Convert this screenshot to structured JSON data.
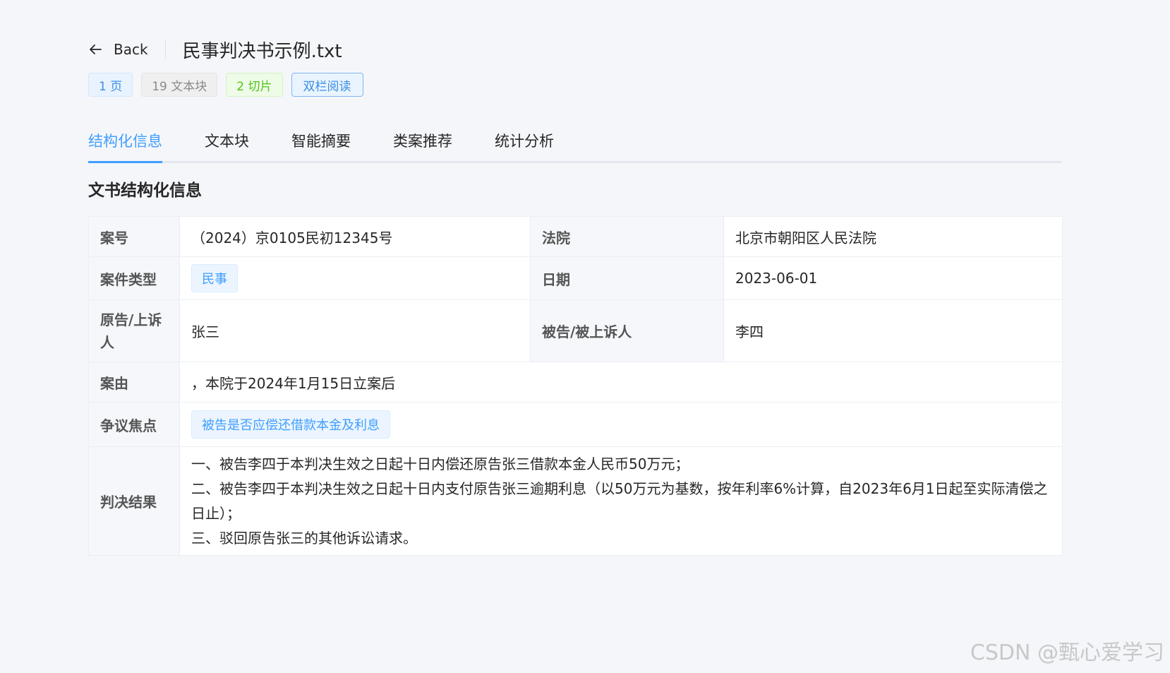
{
  "header": {
    "back_label": "Back",
    "doc_title": "民事判决书示例.txt"
  },
  "tags": {
    "pages": "1 页",
    "blocks": "19 文本块",
    "slices": "2 切片",
    "dual_read": "双栏阅读"
  },
  "tabs": [
    {
      "label": "结构化信息",
      "active": true
    },
    {
      "label": "文本块"
    },
    {
      "label": "智能摘要"
    },
    {
      "label": "类案推荐"
    },
    {
      "label": "统计分析"
    }
  ],
  "section_title": "文书结构化信息",
  "table": {
    "case_no_label": "案号",
    "case_no": "（2024）京0105民初12345号",
    "court_label": "法院",
    "court": "北京市朝阳区人民法院",
    "case_type_label": "案件类型",
    "case_type": "民事",
    "date_label": "日期",
    "date": "2023-06-01",
    "plaintiff_label": "原告/上诉人",
    "plaintiff": "张三",
    "defendant_label": "被告/被上诉人",
    "defendant": "李四",
    "cause_label": "案由",
    "cause": "，本院于2024年1月15日立案后",
    "dispute_label": "争议焦点",
    "dispute": "被告是否应偿还借款本金及利息",
    "judgement_label": "判决结果",
    "judgement": [
      "一、被告李四于本判决生效之日起十日内偿还原告张三借款本金人民币50万元；",
      "二、被告李四于本判决生效之日起十日内支付原告张三逾期利息（以50万元为基数，按年利率6%计算，自2023年6月1日起至实际清偿之日止）；",
      "三、驳回原告张三的其他诉讼请求。"
    ]
  },
  "watermark": "CSDN @甄心爱学习"
}
